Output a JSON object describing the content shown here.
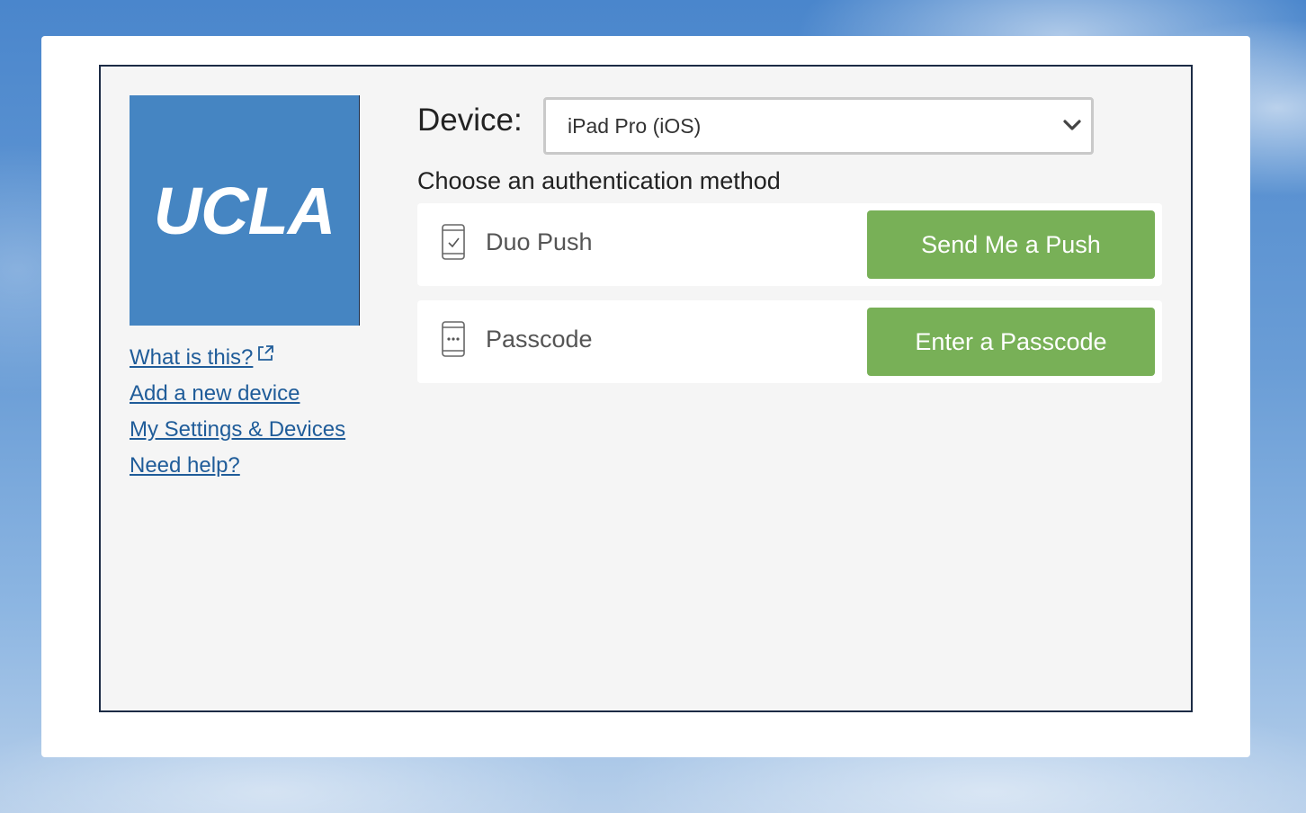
{
  "logo": {
    "text": "UCLA"
  },
  "links": [
    {
      "label": "What is this?"
    },
    {
      "label": "Add a new device"
    },
    {
      "label": "My Settings & Devices"
    },
    {
      "label": "Need help?"
    }
  ],
  "device": {
    "label": "Device:",
    "selected": "iPad Pro (iOS)"
  },
  "choose_label": "Choose an authentication method",
  "methods": [
    {
      "label": "Duo Push",
      "button": "Send Me a Push",
      "icon": "phone-check-icon"
    },
    {
      "label": "Passcode",
      "button": "Enter a Passcode",
      "icon": "phone-dots-icon"
    }
  ],
  "colors": {
    "accent_button": "#78b057",
    "link": "#1f5c99",
    "logo_bg": "#4585c2",
    "frame_border": "#1c2b45"
  }
}
